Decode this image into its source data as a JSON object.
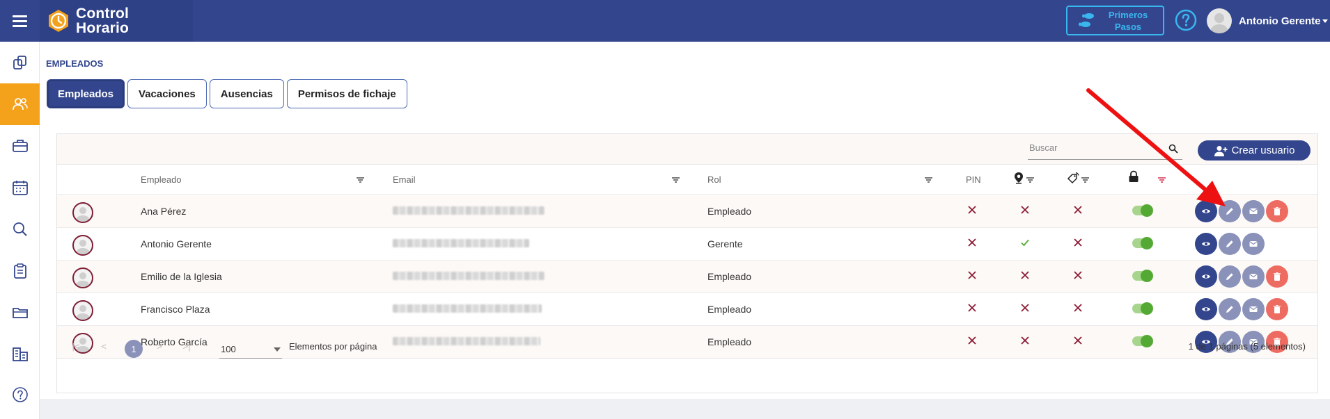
{
  "app": {
    "brand_line1": "Control",
    "brand_line2": "Horario",
    "help_steps_line1": "Primeros",
    "help_steps_line2": "Pasos",
    "user_name": "Antonio Gerente"
  },
  "sidebar": {
    "items": [
      {
        "icon": "copy-icon"
      },
      {
        "icon": "users-icon",
        "active": true
      },
      {
        "icon": "briefcase-icon"
      },
      {
        "icon": "calendar-icon"
      },
      {
        "icon": "search-icon"
      },
      {
        "icon": "clipboard-icon"
      },
      {
        "icon": "folder-icon"
      },
      {
        "icon": "building-icon"
      },
      {
        "icon": "help-circle-icon"
      }
    ]
  },
  "page": {
    "section_title": "EMPLEADOS",
    "tabs": [
      {
        "label": "Empleados",
        "active": true
      },
      {
        "label": "Vacaciones"
      },
      {
        "label": "Ausencias"
      },
      {
        "label": "Permisos de fichaje"
      }
    ]
  },
  "toolbar": {
    "search_placeholder": "Buscar",
    "create_label": "Crear usuario"
  },
  "table": {
    "columns": {
      "employee": "Empleado",
      "email": "Email",
      "role": "Rol",
      "pin": "PIN",
      "location_icon": "map-pin-icon",
      "nfc_icon": "nfc-tag-icon",
      "lock_icon": "lock-icon"
    },
    "rows": [
      {
        "name": "Ana Pérez",
        "role": "Empleado",
        "pin": false,
        "location": false,
        "nfc": false,
        "enabled": true,
        "can_delete": true
      },
      {
        "name": "Antonio Gerente",
        "role": "Gerente",
        "pin": false,
        "location": true,
        "nfc": false,
        "enabled": true,
        "can_delete": false
      },
      {
        "name": "Emilio de la Iglesia",
        "role": "Empleado",
        "pin": false,
        "location": false,
        "nfc": false,
        "enabled": true,
        "can_delete": true
      },
      {
        "name": "Francisco Plaza",
        "role": "Empleado",
        "pin": false,
        "location": false,
        "nfc": false,
        "enabled": true,
        "can_delete": true
      },
      {
        "name": "Roberto García",
        "role": "Empleado",
        "pin": false,
        "location": false,
        "nfc": false,
        "enabled": true,
        "can_delete": true
      }
    ]
  },
  "pagination": {
    "current_page": "1",
    "page_size": "100",
    "page_size_label": "Elementos por página",
    "summary": "1 de 1 páginas (5 elementos)"
  },
  "colors": {
    "header": "#33468d",
    "sidebar_active": "#f4a11c",
    "cross": "#8b1a33",
    "check": "#54a935",
    "delete": "#ee6b62",
    "annotation_arrow": "#ee1111"
  }
}
